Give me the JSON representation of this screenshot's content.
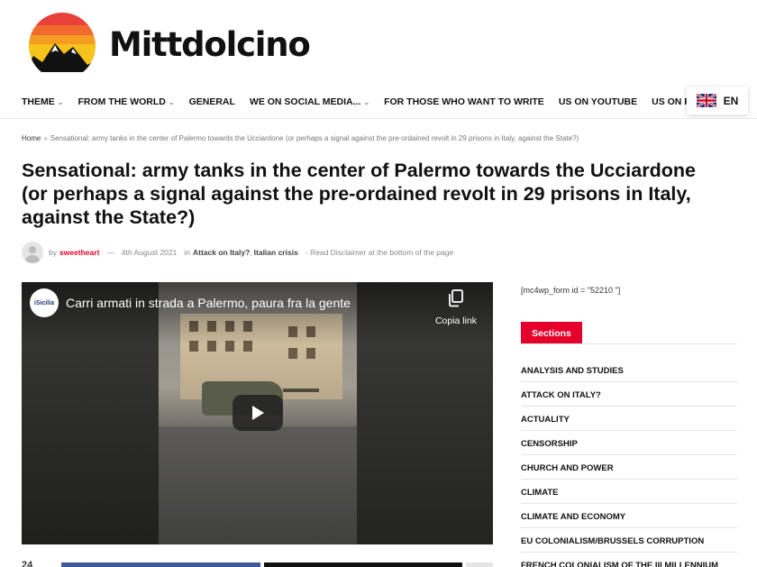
{
  "brand": {
    "name": "Mittdolcino"
  },
  "nav": {
    "items": [
      {
        "label": "THEME",
        "has_dropdown": true
      },
      {
        "label": "FROM THE WORLD",
        "has_dropdown": true
      },
      {
        "label": "GENERAL",
        "has_dropdown": false
      },
      {
        "label": "WE ON SOCIAL MEDIA...",
        "has_dropdown": true
      },
      {
        "label": "FOR THOSE WHO WANT TO WRITE",
        "has_dropdown": false
      },
      {
        "label": "US ON YOUTUBE",
        "has_dropdown": false
      },
      {
        "label": "US ON RUMBLE",
        "has_dropdown": false
      }
    ],
    "language": {
      "label": "EN",
      "flag_icon": "uk-flag-icon"
    }
  },
  "breadcrumb": {
    "home": "Home",
    "separator": "»",
    "current": "Sensational: army tanks in the center of Palermo towards the Ucciardone (or perhaps a signal against the pre-ordained revolt in 29 prisons in Italy, against the State?)"
  },
  "article": {
    "title": "Sensational: army tanks in the center of Palermo towards the Ucciardone (or perhaps a signal against the pre-ordained revolt in 29 prisons in Italy, against the State?)",
    "by": "by",
    "author": "sweetheart",
    "dash": "—",
    "date": "4th August 2021",
    "in": "in",
    "category_1": "Attack on Italy?",
    "comma": ",",
    "category_2": "Italian crisis",
    "disclaimer": "- Read Disclaimer at the bottom of the page"
  },
  "video": {
    "channel_logo_text": "iSicilia",
    "title": "Carri armati in strada a Palermo, paura fra la gente",
    "copy_label": "Copia link",
    "icons": [
      "copy-link-icon",
      "play-icon"
    ]
  },
  "share": {
    "count": "24"
  },
  "sidebar": {
    "form_code": "[mc4wp_form id = \"52210 \"]",
    "sections_label": "Sections",
    "sections": [
      "ANALYSIS AND STUDIES",
      "ATTACK ON ITALY?",
      "ACTUALITY",
      "CENSORSHIP",
      "CHURCH AND POWER",
      "CLIMATE",
      "CLIMATE AND ECONOMY",
      "EU COLONIALISM/BRUSSELS CORRUPTION",
      "FRENCH COLONIALISM OF THE III MILLENNIUM"
    ]
  },
  "colors": {
    "accent": "#e5002b",
    "facebook": "#3b5998",
    "x": "#111111"
  }
}
